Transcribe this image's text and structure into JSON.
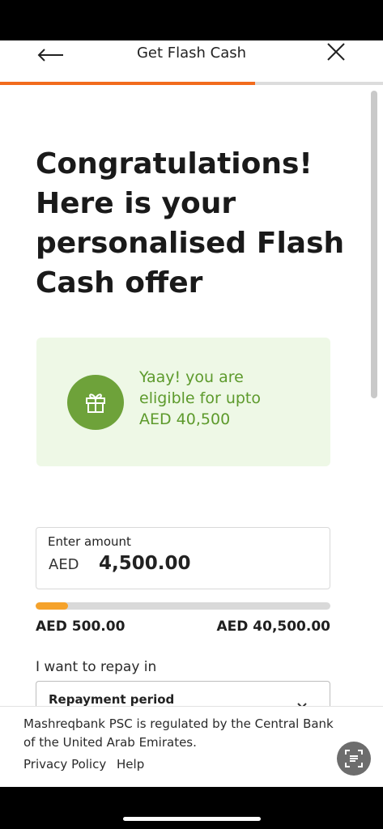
{
  "header": {
    "title": "Get Flash Cash",
    "progress_percent": 66.6
  },
  "headline": {
    "lines": [
      "Congratulations!",
      "Here is your",
      "personalised Flash",
      "Cash offer"
    ]
  },
  "offer": {
    "line1": "Yaay! you are",
    "line2": "eligible for upto",
    "line3": "AED 40,500",
    "icon": "gift-icon"
  },
  "amount": {
    "label": "Enter amount",
    "currency": "AED",
    "value": "4,500.00"
  },
  "slider": {
    "min_label": "AED 500.00",
    "max_label": "AED 40,500.00",
    "fill_fraction": 0.11
  },
  "repay": {
    "label": "I want to repay in",
    "select_label": "Repayment period"
  },
  "footer": {
    "note": "Mashreqbank PSC is regulated by the Central Bank of the United Arab Emirates.",
    "privacy_link": "Privacy Policy",
    "help_link": "Help"
  },
  "colors": {
    "accent_orange": "#f26b1d",
    "slider_orange": "#f5a22b",
    "green": "#6ea23a",
    "card_bg": "#eef8e6"
  }
}
